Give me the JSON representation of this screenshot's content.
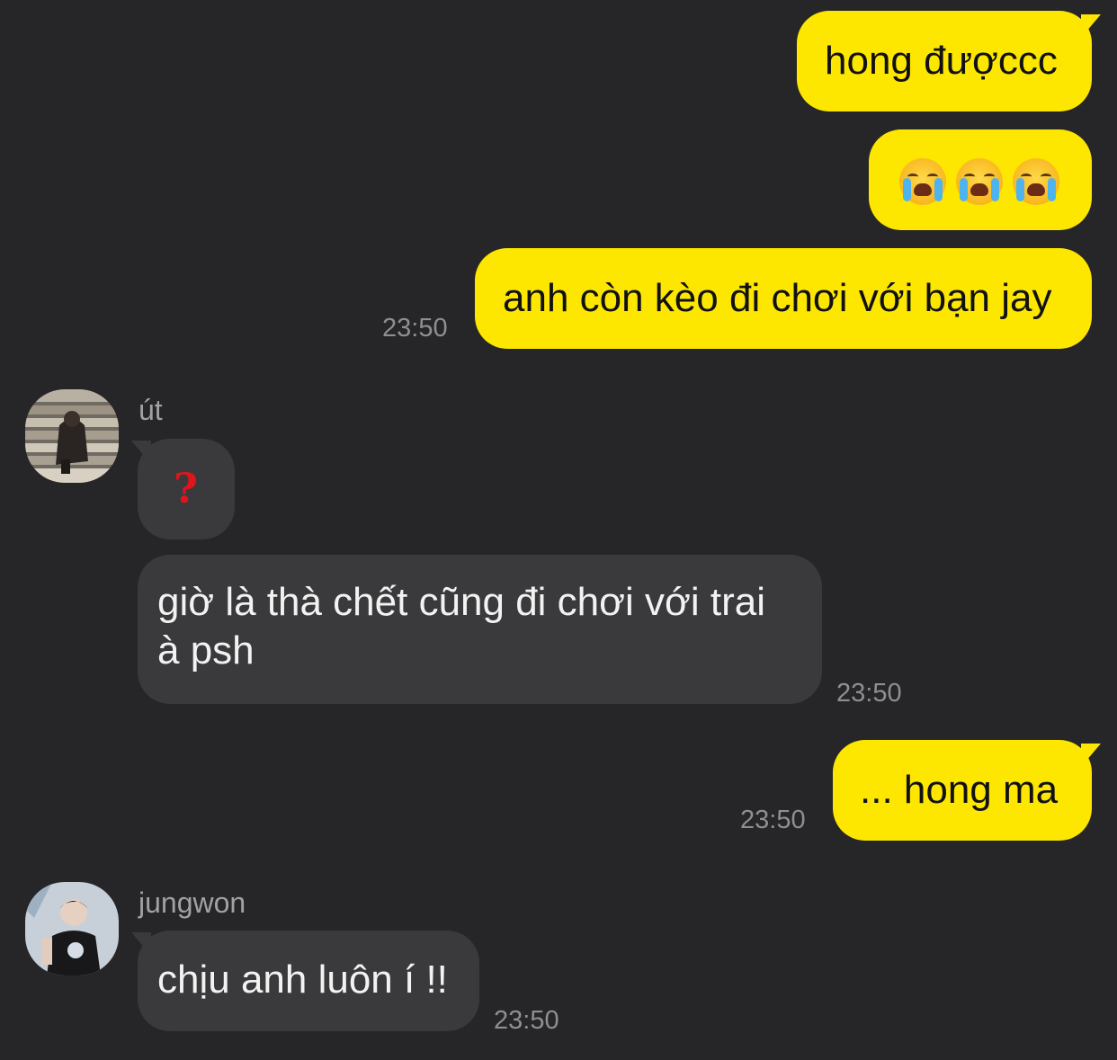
{
  "messages": {
    "m1": {
      "text": "hong đượccc"
    },
    "m2": {
      "emoji": [
        "loudly-crying-face",
        "loudly-crying-face",
        "loudly-crying-face"
      ]
    },
    "m3": {
      "text": "anh còn kèo đi chơi với bạn jay",
      "time": "23:50"
    },
    "m4": {
      "sender": "út",
      "text": "?"
    },
    "m5": {
      "text": "giờ là thà chết cũng đi chơi với trai à psh",
      "time": "23:50"
    },
    "m6": {
      "text": "... hong ma",
      "time": "23:50"
    },
    "m7": {
      "sender": "jungwon",
      "text": "chịu anh luôn í !!",
      "time": "23:50"
    }
  },
  "colors": {
    "background": "#262628",
    "outgoing_bubble": "#fde600",
    "incoming_bubble": "#3a3a3c",
    "timestamp": "#8e8e93"
  }
}
